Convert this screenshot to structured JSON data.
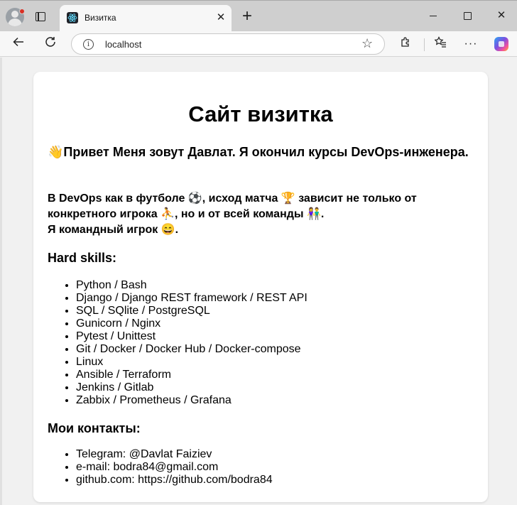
{
  "browser": {
    "tab_title": "Визитка",
    "tab_close": "✕",
    "new_tab": "+",
    "url": "localhost",
    "window_close": "✕"
  },
  "page": {
    "title": "Сайт визитка",
    "greeting": "👋Привет Меня зовут Давлат. Я окончил курсы DevOps-инженера.",
    "devops_line1": "В DevOps как в футболе ⚽, исход матча 🏆 зависит не только от конкретного игрока ⛹, но и от всей команды 👫.",
    "devops_line2": "Я командный игрок 😄.",
    "hard_skills_title": "Hard skills:",
    "hard_skills": [
      "Python / Bash",
      "Django / Django REST framework / REST API",
      "SQL / SQlite / PostgreSQL",
      "Gunicorn / Nginx",
      "Pytest / Unittest",
      "Git / Docker / Docker Hub / Docker-compose",
      "Linux",
      "Ansible / Terraform",
      "Jenkins / Gitlab",
      "Zabbix / Prometheus / Grafana"
    ],
    "contacts_title": "Мои контакты:",
    "contacts": [
      "Telegram: @Davlat Faiziev",
      "e-mail: bodra84@gmail.com",
      "github.com: https://github.com/bodra84"
    ]
  }
}
